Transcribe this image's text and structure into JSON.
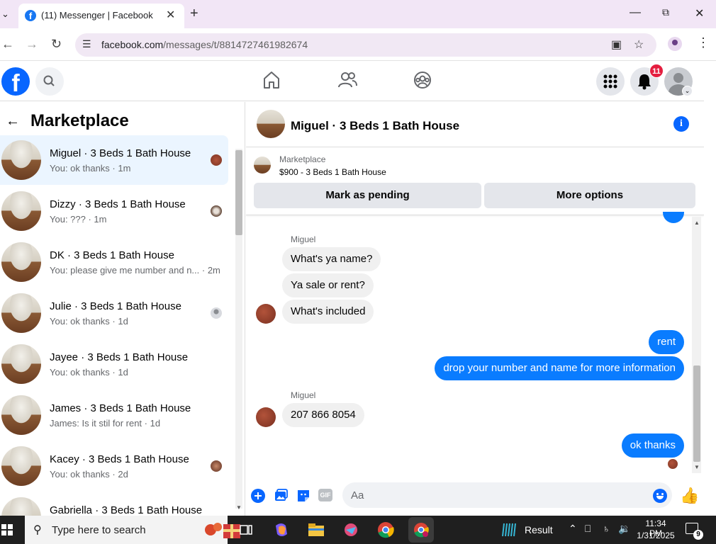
{
  "browser": {
    "tab_title": "(11) Messenger | Facebook",
    "tab_favicon": "f",
    "new_tab_glyph": "+",
    "url_host": "facebook.com",
    "url_path": "/messages/t/8814727461982674",
    "window_controls": [
      "minimize-icon",
      "restore-icon",
      "close-icon"
    ]
  },
  "fb_header": {
    "logo": "f",
    "notification_count": "11",
    "nav_icons": [
      "home-icon",
      "friends-icon",
      "groups-icon"
    ],
    "accent": "#0866ff"
  },
  "left_panel": {
    "title": "Marketplace",
    "conversations": [
      {
        "name": "Miguel · 3 Beds 1 Bath House",
        "preview": "You: ok thanks · 1m",
        "active": true
      },
      {
        "name": "Dizzy · 3 Beds 1 Bath House",
        "preview": "You: ??? · 1m"
      },
      {
        "name": "DK · 3 Beds 1 Bath House",
        "preview": "You: please give me number and n... · 2m"
      },
      {
        "name": "Julie · 3 Beds 1 Bath House",
        "preview": "You: ok thanks · 1d"
      },
      {
        "name": "Jayee · 3 Beds 1 Bath House",
        "preview": "You: ok thanks · 1d"
      },
      {
        "name": "James · 3 Beds 1 Bath House",
        "preview": "James: Is it stil for rent · 1d"
      },
      {
        "name": "Kacey · 3 Beds 1 Bath House",
        "preview": "You: ok thanks · 2d"
      },
      {
        "name": "Gabriella · 3 Beds 1 Bath House",
        "preview": ""
      }
    ]
  },
  "chat": {
    "title": "Miguel · 3 Beds 1 Bath House",
    "marketplace_label": "Marketplace",
    "listing": "$900 - 3 Beds 1 Bath House",
    "mark_pending": "Mark as pending",
    "more_options": "More options",
    "messages": [
      {
        "from": "Miguel",
        "sender_label": "Miguel",
        "text": "What's ya name?"
      },
      {
        "from": "Miguel",
        "text": "Ya sale or rent?"
      },
      {
        "from": "Miguel",
        "text": "What's included"
      },
      {
        "from": "me",
        "text": "rent"
      },
      {
        "from": "me",
        "text": "drop your number and name for more information"
      },
      {
        "from": "Miguel",
        "sender_label": "Miguel",
        "text": "207 866 8054"
      },
      {
        "from": "me",
        "text": "ok thanks"
      }
    ],
    "composer_placeholder": "Aa",
    "gif_label": "GIF",
    "out_bubble_color": "#0a7cff"
  },
  "taskbar": {
    "search_placeholder": "Type here to search",
    "result_label": "Result",
    "time": "11:34 PM",
    "date": "1/31/2025",
    "notification_count": "9"
  }
}
